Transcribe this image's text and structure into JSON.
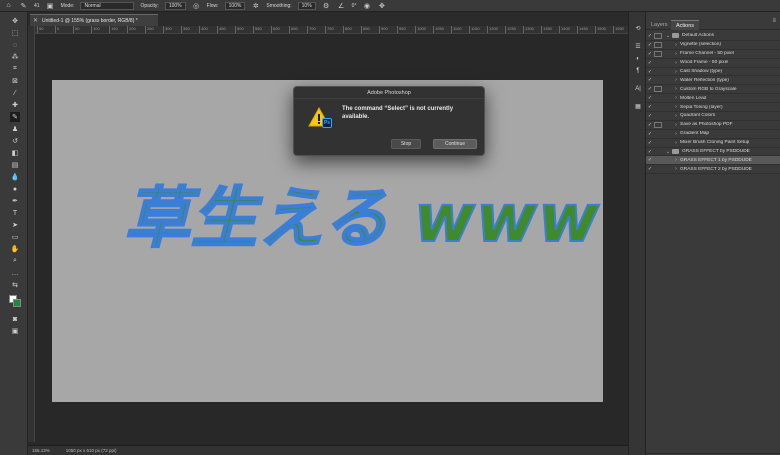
{
  "options_bar": {
    "mode_label": "Mode:",
    "mode_value": "Normal",
    "opacity_label": "Opacity:",
    "opacity_value": "100%",
    "flow_label": "Flow:",
    "flow_value": "100%",
    "smoothing_label": "Smoothing:",
    "smoothing_value": "10%",
    "angle_value": "0°",
    "brush_size": "41"
  },
  "document_tab": {
    "title": "Untitled-1 @ 155% (grass border, RGB/8) *"
  },
  "ruler_ticks": [
    "50",
    "0",
    "50",
    "100",
    "150",
    "200",
    "250",
    "300",
    "350",
    "400",
    "450",
    "500",
    "550",
    "600",
    "650",
    "700",
    "750",
    "800",
    "850",
    "900",
    "950",
    "1000",
    "1050",
    "1100",
    "1150",
    "1200",
    "1250",
    "1300",
    "1350",
    "1400",
    "1450",
    "1500",
    "1550"
  ],
  "canvas": {
    "text": "草生える www",
    "fill_color": "#3f8a2a",
    "outline_color": "#3b7ed8",
    "background": "#a7a7a7"
  },
  "status_bar": {
    "zoom": "155.13%",
    "doc_info": "1050 px x 610 px (72 ppi)"
  },
  "dialog": {
    "title": "Adobe Photoshop",
    "message": "The command “Select” is not currently available.",
    "stop_label": "Stop",
    "continue_label": "Continue",
    "badge": "Ps"
  },
  "panel": {
    "tabs": [
      "Layers",
      "Actions"
    ],
    "active_tab": "Actions",
    "rows": [
      {
        "name": "Default Actions",
        "type": "set",
        "dialog": true,
        "highlight": false
      },
      {
        "name": "Vignette (selection)",
        "type": "action",
        "dialog": true,
        "highlight": false
      },
      {
        "name": "Frame Channel - 50 pixel",
        "type": "action",
        "dialog": true,
        "highlight": false
      },
      {
        "name": "Wood Frame - 50 pixel",
        "type": "action",
        "dialog": false,
        "highlight": false
      },
      {
        "name": "Cast Shadow (type)",
        "type": "action",
        "dialog": false,
        "highlight": false
      },
      {
        "name": "Water Reflection (type)",
        "type": "action",
        "dialog": false,
        "highlight": false
      },
      {
        "name": "Custom RGB to Grayscale",
        "type": "action",
        "dialog": true,
        "highlight": false
      },
      {
        "name": "Molten Lead",
        "type": "action",
        "dialog": false,
        "highlight": false
      },
      {
        "name": "Sepia Toning (layer)",
        "type": "action",
        "dialog": false,
        "highlight": false
      },
      {
        "name": "Quadrant Colors",
        "type": "action",
        "dialog": false,
        "highlight": false
      },
      {
        "name": "Save as Photoshop PDF",
        "type": "action",
        "dialog": true,
        "highlight": false
      },
      {
        "name": "Gradient Map",
        "type": "action",
        "dialog": false,
        "highlight": false
      },
      {
        "name": "Mixer Brush Cloning Paint Setup",
        "type": "action",
        "dialog": false,
        "highlight": false
      },
      {
        "name": "GRASS EFFECT by PSDDUDE",
        "type": "set",
        "dialog": false,
        "highlight": false
      },
      {
        "name": "GRASS EFFECT 1 by PSDDUDE",
        "type": "action",
        "dialog": false,
        "highlight": true
      },
      {
        "name": "GRASS EFFECT 2 by PSDDUDE",
        "type": "action",
        "dialog": false,
        "highlight": false
      }
    ]
  },
  "colors": {
    "foreground": "#ffffff",
    "background": "#1f8a3c",
    "ps_blue": "#31a8ff",
    "warning_yellow": "#f5c518"
  }
}
